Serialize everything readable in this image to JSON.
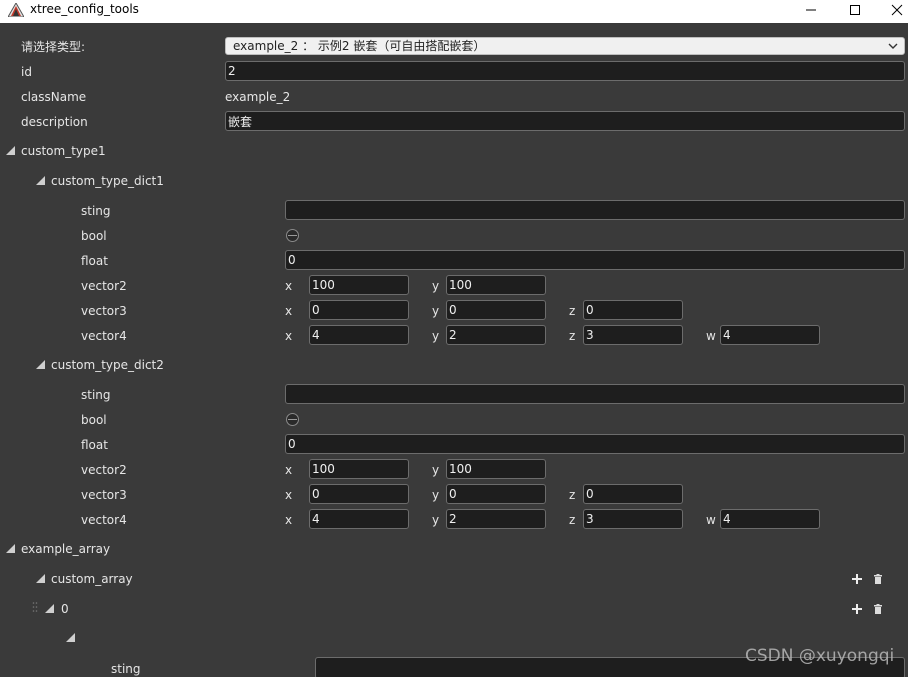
{
  "window": {
    "title": "xtree_config_tools"
  },
  "header": {
    "type_label": "请选择类型:",
    "type_value": "example_2 ： 示例2 嵌套（可自由搭配嵌套）",
    "id_label": "id",
    "id_value": "2",
    "classname_label": "className",
    "classname_value": "example_2",
    "description_label": "description",
    "description_value": "嵌套"
  },
  "custom_type1": {
    "label": "custom_type1",
    "dict1": {
      "label": "custom_type_dict1",
      "sting_label": "sting",
      "sting_value": "",
      "bool_label": "bool",
      "float_label": "float",
      "float_value": "0",
      "vector2_label": "vector2",
      "vector2": {
        "x": "100",
        "y": "100"
      },
      "vector3_label": "vector3",
      "vector3": {
        "x": "0",
        "y": "0",
        "z": "0"
      },
      "vector4_label": "vector4",
      "vector4": {
        "x": "4",
        "y": "2",
        "z": "3",
        "w": "4"
      }
    },
    "dict2": {
      "label": "custom_type_dict2",
      "sting_label": "sting",
      "sting_value": "",
      "bool_label": "bool",
      "float_label": "float",
      "float_value": "0",
      "vector2_label": "vector2",
      "vector2": {
        "x": "100",
        "y": "100"
      },
      "vector3_label": "vector3",
      "vector3": {
        "x": "0",
        "y": "0",
        "z": "0"
      },
      "vector4_label": "vector4",
      "vector4": {
        "x": "4",
        "y": "2",
        "z": "3",
        "w": "4"
      }
    }
  },
  "axes": {
    "x": "x",
    "y": "y",
    "z": "z",
    "w": "w"
  },
  "example_array": {
    "label": "example_array",
    "custom_array_label": "custom_array",
    "item0_label": "0",
    "sting_label": "sting"
  },
  "watermark": "CSDN @xuyongqi",
  "icons": {
    "add": "plus-icon",
    "delete": "trash-icon"
  }
}
